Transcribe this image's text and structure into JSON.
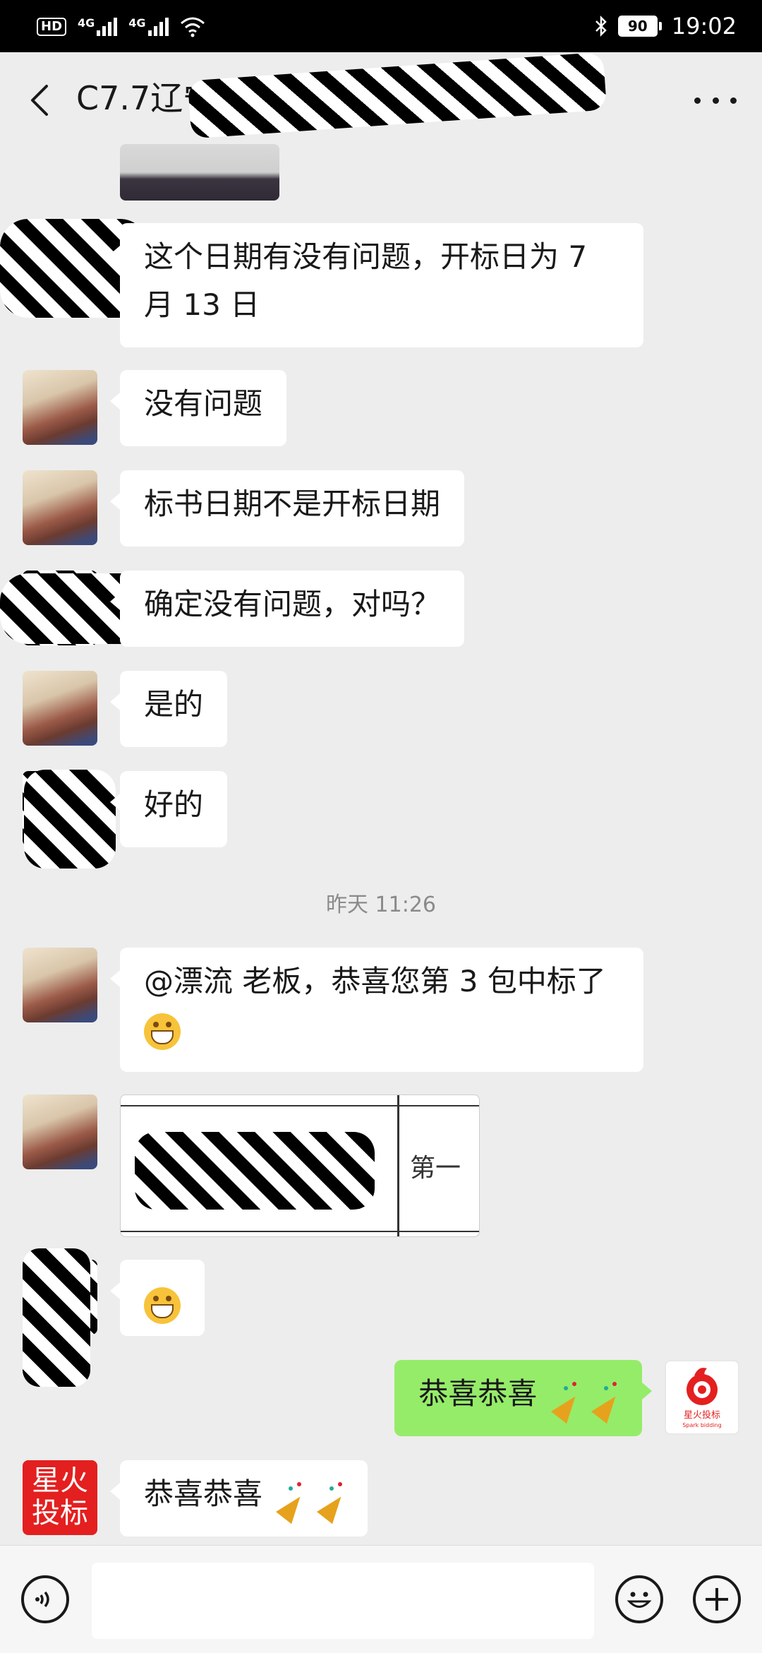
{
  "status_bar": {
    "hd_label": "HD",
    "network_1": "4G",
    "network_2": "4G",
    "battery": "90",
    "time": "19:02"
  },
  "header": {
    "title": "C7.7辽宁",
    "back_icon": "chevron-left-icon",
    "more_icon": "more-dots-icon"
  },
  "messages": [
    {
      "side": "left",
      "avatar": "redacted",
      "type": "image-partial"
    },
    {
      "side": "left",
      "avatar": "redacted",
      "text": "这个日期有没有问题，开标日为 7 月 13 日"
    },
    {
      "side": "left",
      "avatar": "user",
      "text": "没有问题"
    },
    {
      "side": "left",
      "avatar": "user",
      "text": "标书日期不是开标日期"
    },
    {
      "side": "left",
      "avatar": "redacted",
      "text": "确定没有问题，对吗？"
    },
    {
      "side": "left",
      "avatar": "user",
      "text": "是的"
    },
    {
      "side": "left",
      "avatar": "redacted",
      "text": "好的"
    },
    {
      "type": "timestamp",
      "text": "昨天 11:26"
    },
    {
      "side": "left",
      "avatar": "user",
      "text": "@漂流 老板，恭喜您第 3 包中标了"
    },
    {
      "side": "left",
      "avatar": "user",
      "type": "image",
      "image_text": "第一"
    },
    {
      "side": "left",
      "avatar": "redacted",
      "type": "emoji"
    },
    {
      "side": "right",
      "avatar": "brand-logo",
      "text": "恭喜恭喜",
      "avatar_caption": "星火投标",
      "avatar_caption_en": "Spark bidding"
    },
    {
      "side": "left",
      "avatar": "brand",
      "text": "恭喜恭喜",
      "avatar_text": "星火投标"
    }
  ],
  "input_bar": {
    "voice_icon": "voice-icon",
    "emoji_icon": "emoji-icon",
    "plus_icon": "plus-icon"
  },
  "colors": {
    "background": "#ededed",
    "bubble_mine": "#95ec69",
    "bubble_other": "#ffffff",
    "brand_red": "#e41f1f"
  }
}
